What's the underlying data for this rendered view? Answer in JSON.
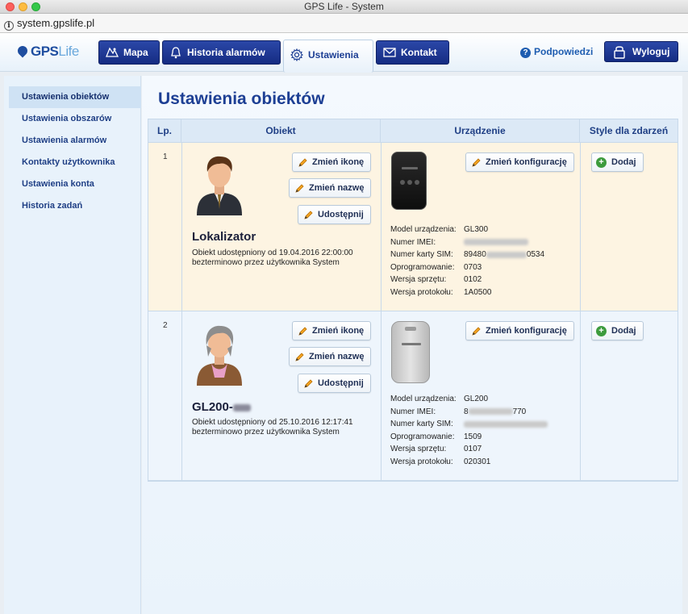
{
  "window": {
    "title": "GPS Life - System",
    "url": "system.gpslife.pl"
  },
  "header": {
    "logo_main": "GPS",
    "logo_sub": "Life",
    "nav": [
      {
        "label": "Mapa",
        "icon": "map-icon"
      },
      {
        "label": "Historia alarmów",
        "icon": "bell-icon"
      },
      {
        "label": "Ustawienia",
        "icon": "gear-icon",
        "active": true
      },
      {
        "label": "Kontakt",
        "icon": "envelope-icon"
      }
    ],
    "help_label": "Podpowiedzi",
    "logout_label": "Wyloguj"
  },
  "sidebar": {
    "items": [
      {
        "label": "Ustawienia obiektów",
        "active": true
      },
      {
        "label": "Ustawienia obszarów"
      },
      {
        "label": "Ustawienia alarmów"
      },
      {
        "label": "Kontakty użytkownika"
      },
      {
        "label": "Ustawienia konta"
      },
      {
        "label": "Historia zadań"
      }
    ]
  },
  "main": {
    "title": "Ustawienia obiektów",
    "columns": [
      "Lp.",
      "Obiekt",
      "Urządzenie",
      "Style dla zdarzeń"
    ],
    "buttons": {
      "change_icon": "Zmień ikonę",
      "change_name": "Zmień nazwę",
      "share": "Udostępnij",
      "change_config": "Zmień konfigurację",
      "add": "Dodaj"
    },
    "spec_labels": {
      "model": "Model urządzenia:",
      "imei": "Numer IMEI:",
      "sim": "Numer karty SIM:",
      "firmware": "Oprogramowanie:",
      "hardware": "Wersja sprzętu:",
      "protocol": "Wersja protokołu:"
    },
    "rows": [
      {
        "lp": "1",
        "name": "Lokalizator",
        "shared_line1": "Obiekt udostępniony od 19.04.2016 22:00:00",
        "shared_line2": "bezterminowo przez użytkownika System",
        "avatar": "man-avatar-icon",
        "model": "GL300",
        "imei": "",
        "sim": "89480",
        "sim_tail": "0534",
        "firmware": "0703",
        "hardware": "0102",
        "protocol": "1A0500"
      },
      {
        "lp": "2",
        "name": "GL200-",
        "shared_line1": "Obiekt udostępniony od 25.10.2016 12:17:41",
        "shared_line2": "bezterminowo przez użytkownika System",
        "avatar": "old-woman-avatar-icon",
        "model": "GL200",
        "imei": "8",
        "imei_tail": "770",
        "sim": "",
        "firmware": "1509",
        "hardware": "0107",
        "protocol": "020301"
      }
    ]
  },
  "colors": {
    "nav_blue": "#1d3a96",
    "row_odd": "#fdf4e2",
    "row_even": "#eef5fc",
    "title_blue": "#1d3f94"
  }
}
